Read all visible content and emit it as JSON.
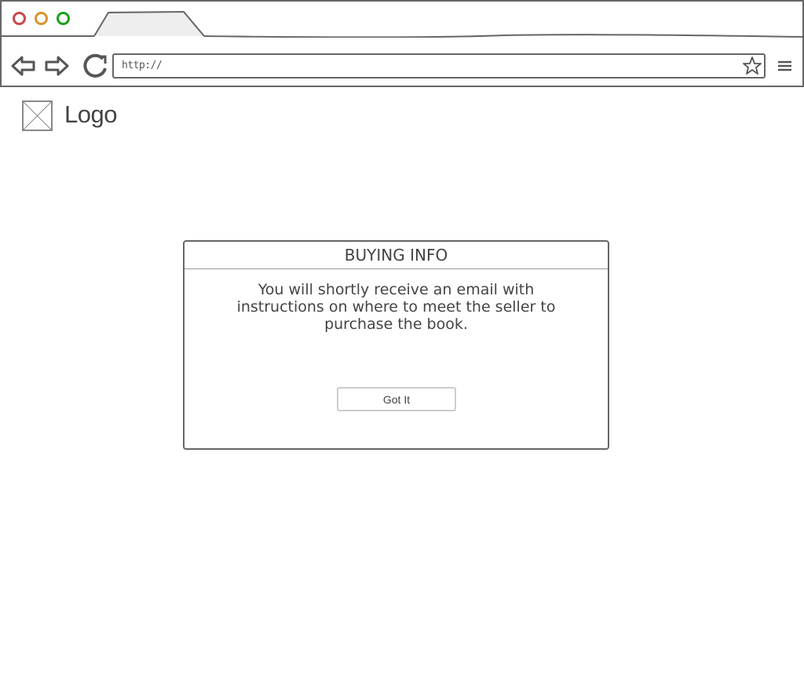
{
  "browser": {
    "window_controls": {
      "close_color": "#c8484e",
      "minimize_color": "#d9932b",
      "maximize_color": "#1aa01c"
    },
    "address_bar": {
      "value": "http://"
    },
    "icons": {
      "back": "back-arrow-icon",
      "forward": "forward-arrow-icon",
      "reload": "reload-icon",
      "bookmark": "star-icon",
      "menu": "hamburger-menu-icon"
    }
  },
  "header": {
    "logo_label": "Logo"
  },
  "dialog": {
    "title": "BUYING INFO",
    "message": "You will shortly receive an email with instructions on where to meet the seller to purchase the book.",
    "confirm_label": "Got It"
  }
}
